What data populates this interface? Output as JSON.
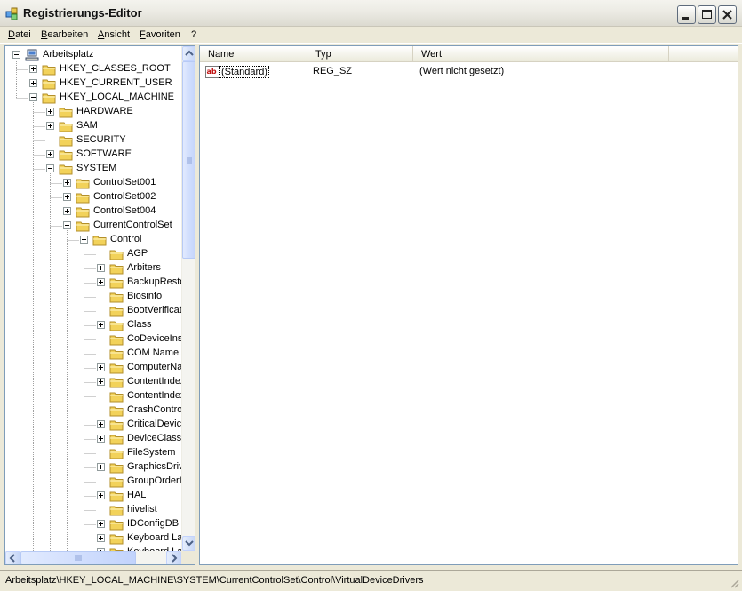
{
  "window": {
    "title": "Registrierungs-Editor"
  },
  "menu": [
    "Datei",
    "Bearbeiten",
    "Ansicht",
    "Favoriten",
    "?"
  ],
  "tree": {
    "items": [
      {
        "label": "Arbeitsplatz",
        "level": 0,
        "expander": "minus",
        "icon": "computer-icon"
      },
      {
        "label": "HKEY_CLASSES_ROOT",
        "level": 1,
        "expander": "plus"
      },
      {
        "label": "HKEY_CURRENT_USER",
        "level": 1,
        "expander": "plus"
      },
      {
        "label": "HKEY_LOCAL_MACHINE",
        "level": 1,
        "expander": "minus"
      },
      {
        "label": "HARDWARE",
        "level": 2,
        "expander": "plus"
      },
      {
        "label": "SAM",
        "level": 2,
        "expander": "plus"
      },
      {
        "label": "SECURITY",
        "level": 2,
        "expander": "none"
      },
      {
        "label": "SOFTWARE",
        "level": 2,
        "expander": "plus"
      },
      {
        "label": "SYSTEM",
        "level": 2,
        "expander": "minus"
      },
      {
        "label": "ControlSet001",
        "level": 3,
        "expander": "plus"
      },
      {
        "label": "ControlSet002",
        "level": 3,
        "expander": "plus"
      },
      {
        "label": "ControlSet004",
        "level": 3,
        "expander": "plus"
      },
      {
        "label": "CurrentControlSet",
        "level": 3,
        "expander": "minus"
      },
      {
        "label": "Control",
        "level": 4,
        "expander": "minus"
      },
      {
        "label": "AGP",
        "level": 5,
        "expander": "none"
      },
      {
        "label": "Arbiters",
        "level": 5,
        "expander": "plus"
      },
      {
        "label": "BackupRestore",
        "level": 5,
        "expander": "plus"
      },
      {
        "label": "Biosinfo",
        "level": 5,
        "expander": "none"
      },
      {
        "label": "BootVerificationProgram",
        "level": 5,
        "expander": "none"
      },
      {
        "label": "Class",
        "level": 5,
        "expander": "plus"
      },
      {
        "label": "CoDeviceInstallers",
        "level": 5,
        "expander": "none"
      },
      {
        "label": "COM Name Arbiter",
        "level": 5,
        "expander": "none"
      },
      {
        "label": "ComputerName",
        "level": 5,
        "expander": "plus"
      },
      {
        "label": "ContentIndex",
        "level": 5,
        "expander": "plus"
      },
      {
        "label": "ContentIndexCommon",
        "level": 5,
        "expander": "none"
      },
      {
        "label": "CrashControl",
        "level": 5,
        "expander": "none"
      },
      {
        "label": "CriticalDeviceDatabase",
        "level": 5,
        "expander": "plus"
      },
      {
        "label": "DeviceClasses",
        "level": 5,
        "expander": "plus"
      },
      {
        "label": "FileSystem",
        "level": 5,
        "expander": "none"
      },
      {
        "label": "GraphicsDrivers",
        "level": 5,
        "expander": "plus"
      },
      {
        "label": "GroupOrderList",
        "level": 5,
        "expander": "none"
      },
      {
        "label": "HAL",
        "level": 5,
        "expander": "plus"
      },
      {
        "label": "hivelist",
        "level": 5,
        "expander": "none"
      },
      {
        "label": "IDConfigDB",
        "level": 5,
        "expander": "plus"
      },
      {
        "label": "Keyboard Layout",
        "level": 5,
        "expander": "plus"
      },
      {
        "label": "Keyboard Layouts",
        "level": 5,
        "expander": "plus"
      }
    ]
  },
  "list": {
    "columns": [
      "Name",
      "Typ",
      "Wert"
    ],
    "rows": [
      {
        "name": "(Standard)",
        "type": "REG_SZ",
        "value": "(Wert nicht gesetzt)",
        "icon": "string-value-icon"
      }
    ]
  },
  "status": {
    "path": "Arbeitsplatz\\HKEY_LOCAL_MACHINE\\SYSTEM\\CurrentControlSet\\Control\\VirtualDeviceDrivers"
  },
  "colors": {
    "folder": "#f2d25a",
    "border": "#7f9db9",
    "chrome": "#ece9d8"
  }
}
